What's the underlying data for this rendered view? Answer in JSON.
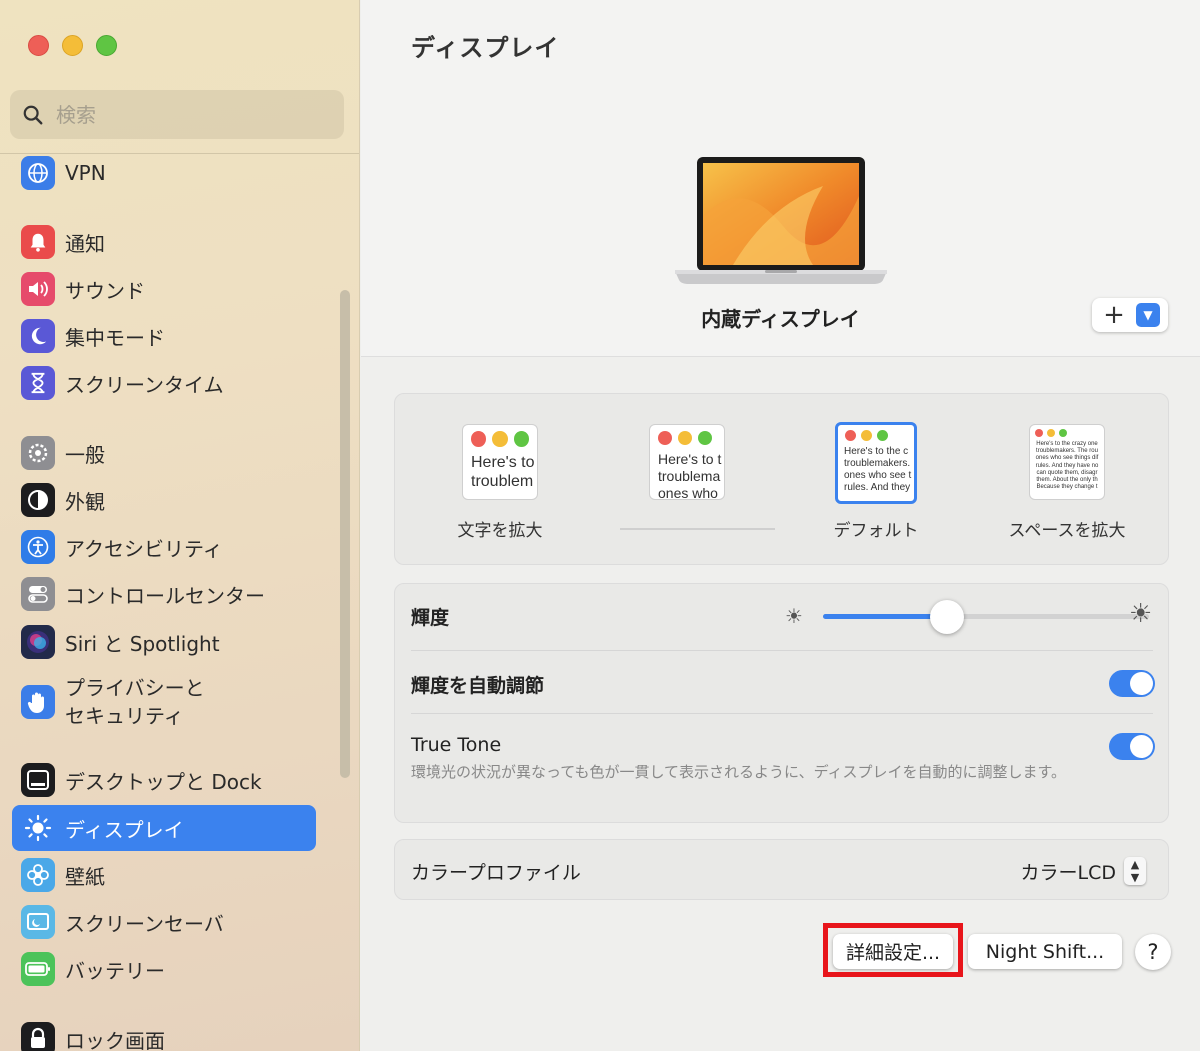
{
  "sidebar": {
    "search_placeholder": "検索",
    "items": [
      {
        "label": "VPN",
        "icon": "globe-icon",
        "color": "#3b7de8"
      },
      {
        "label": "通知",
        "icon": "bell-icon",
        "color": "#ea4b4b"
      },
      {
        "label": "サウンド",
        "icon": "speaker-icon",
        "color": "#e64b6b"
      },
      {
        "label": "集中モード",
        "icon": "moon-icon",
        "color": "#5a58d6"
      },
      {
        "label": "スクリーンタイム",
        "icon": "hourglass-icon",
        "color": "#5a58d6"
      },
      {
        "label": "一般",
        "icon": "gear-icon",
        "color": "#8e8e92"
      },
      {
        "label": "外観",
        "icon": "appearance-icon",
        "color": "#1c1c1e"
      },
      {
        "label": "アクセシビリティ",
        "icon": "accessibility-icon",
        "color": "#2f7ce8"
      },
      {
        "label": "コントロールセンター",
        "icon": "toggles-icon",
        "color": "#8e8e92"
      },
      {
        "label": "Siri と Spotlight",
        "icon": "siri-icon",
        "color": "#222a4a"
      },
      {
        "label": "プライバシーと\nセキュリティ",
        "icon": "hand-icon",
        "color": "#3b7de8"
      },
      {
        "label": "デスクトップと Dock",
        "icon": "dock-icon",
        "color": "#1c1c1e"
      },
      {
        "label": "ディスプレイ",
        "icon": "brightness-icon",
        "color": "#3b82ee"
      },
      {
        "label": "壁紙",
        "icon": "flower-icon",
        "color": "#4aa8e8"
      },
      {
        "label": "スクリーンセーバ",
        "icon": "screensaver-icon",
        "color": "#5ab8e6"
      },
      {
        "label": "バッテリー",
        "icon": "battery-icon",
        "color": "#4cc35a"
      },
      {
        "label": "ロック画面",
        "icon": "lock-icon",
        "color": "#1c1c1e"
      }
    ],
    "selected": "ディスプレイ"
  },
  "main": {
    "title": "ディスプレイ",
    "display_name": "内蔵ディスプレイ",
    "add_button": "+",
    "resolutions": [
      {
        "label": "文字を拡大",
        "sample": "Here's to\ntroublem"
      },
      {
        "label": "",
        "sample": "Here's to t\ntroublema\nones who"
      },
      {
        "label": "デフォルト",
        "sample": "Here's to the c\ntroublemakers.\nones who see t\nrules. And they"
      },
      {
        "label": "スペースを拡大",
        "sample": "Here's to the crazy one\ntroublemakers. The rou\nones who see things dif\nrules. And they have no\ncan quote them, disagr\nthem. About the only th\nBecause they change t"
      }
    ],
    "selected_resolution": "デフォルト",
    "brightness": {
      "label": "輝度",
      "value": 0.38
    },
    "auto_brightness": {
      "label": "輝度を自動調節",
      "on": true
    },
    "true_tone": {
      "label": "True Tone",
      "on": true,
      "description": "環境光の状況が異なっても色が一貫して表示されるように、ディスプレイを自動的に調整します。"
    },
    "color_profile": {
      "label": "カラープロファイル",
      "value": "カラーLCD"
    },
    "buttons": {
      "advanced": "詳細設定...",
      "night_shift": "Night Shift...",
      "help": "?"
    }
  },
  "colors": {
    "accent": "#3b82ee",
    "highlight_box": "#e8151b"
  }
}
